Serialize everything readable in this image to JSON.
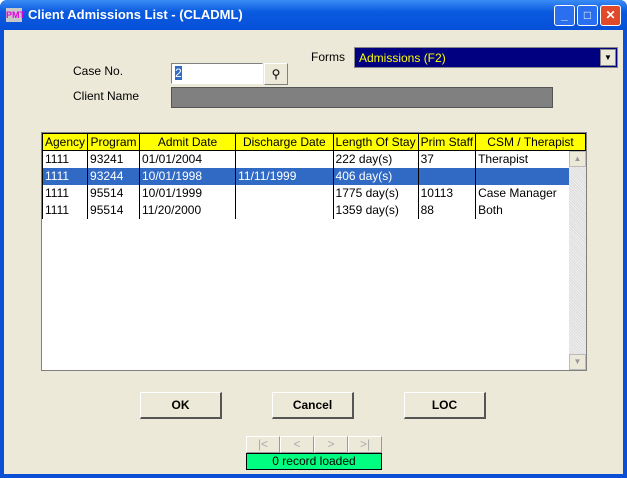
{
  "window": {
    "title": "Client Admissions List - (CLADML)",
    "icon_text": "PMT"
  },
  "form": {
    "forms_label": "Forms",
    "forms_value": "Admissions (F2)",
    "case_no_label": "Case No.",
    "case_no_value": "2",
    "client_name_label": "Client Name",
    "client_name_value": ""
  },
  "grid": {
    "columns": [
      "Agency",
      "Program",
      "Admit Date",
      "Discharge Date",
      "Length Of Stay",
      "Prim Staff",
      "CSM / Therapist"
    ],
    "rows": [
      [
        "1111",
        "93241",
        "01/01/2004",
        "",
        "222 day(s)",
        "37",
        "Therapist"
      ],
      [
        "1111",
        "93244",
        "10/01/1998",
        "11/11/1999",
        "406 day(s)",
        "",
        ""
      ],
      [
        "1111",
        "95514",
        "10/01/1999",
        "",
        "1775 day(s)",
        "10113",
        "Case Manager"
      ],
      [
        "1111",
        "95514",
        "11/20/2000",
        "",
        "1359 day(s)",
        "88",
        "Both"
      ]
    ],
    "selected_row": 1
  },
  "buttons": {
    "ok": "OK",
    "cancel": "Cancel",
    "loc": "LOC"
  },
  "nav": {
    "first": "|<",
    "prev": "<",
    "next": ">",
    "last": ">|"
  },
  "status": "0 record loaded"
}
